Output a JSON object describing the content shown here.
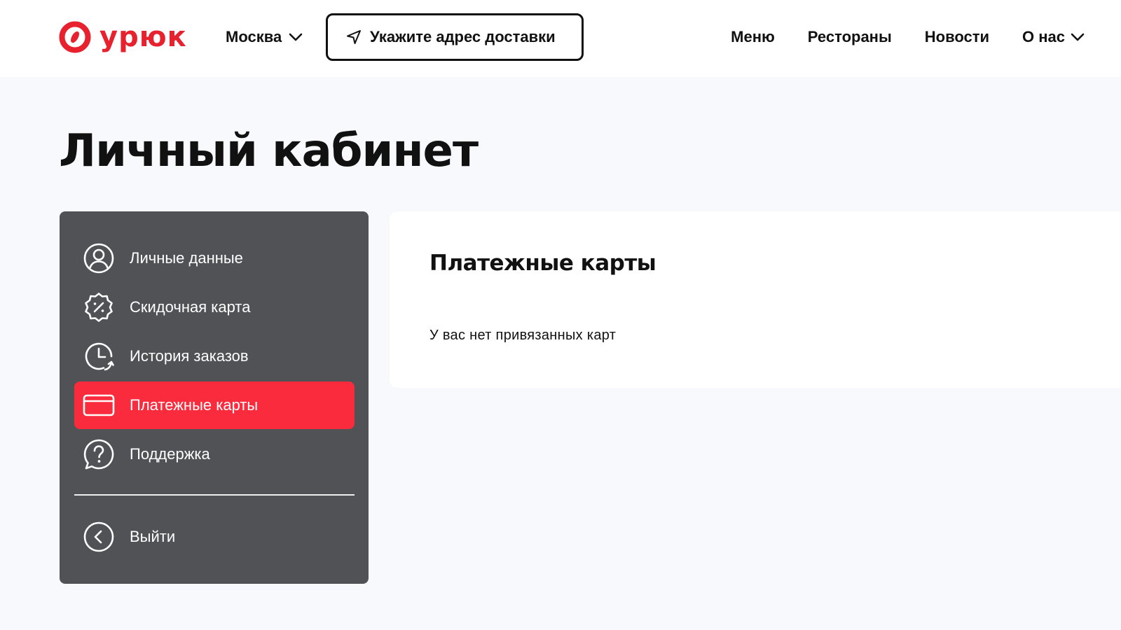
{
  "header": {
    "logo_text": "урюк",
    "city": "Москва",
    "address_button_label": "Укажите адрес доставки",
    "nav": [
      {
        "label": "Меню"
      },
      {
        "label": "Рестораны"
      },
      {
        "label": "Новости"
      },
      {
        "label": "О нас"
      }
    ]
  },
  "page": {
    "title": "Личный кабинет"
  },
  "sidebar": {
    "items": [
      {
        "label": "Личные данные",
        "icon": "user-circle-icon"
      },
      {
        "label": "Скидочная карта",
        "icon": "discount-badge-icon"
      },
      {
        "label": "История заказов",
        "icon": "history-clock-icon"
      },
      {
        "label": "Платежные карты",
        "icon": "credit-card-icon",
        "active": true
      },
      {
        "label": "Поддержка",
        "icon": "question-bubble-icon"
      }
    ],
    "logout_label": "Выйти"
  },
  "content": {
    "title": "Платежные карты",
    "empty_text": "У вас нет привязанных карт"
  },
  "colors": {
    "brand": "#e8212f",
    "active": "#f92b3d",
    "sidebar_bg": "#505256",
    "page_bg": "#f8f9fc"
  }
}
